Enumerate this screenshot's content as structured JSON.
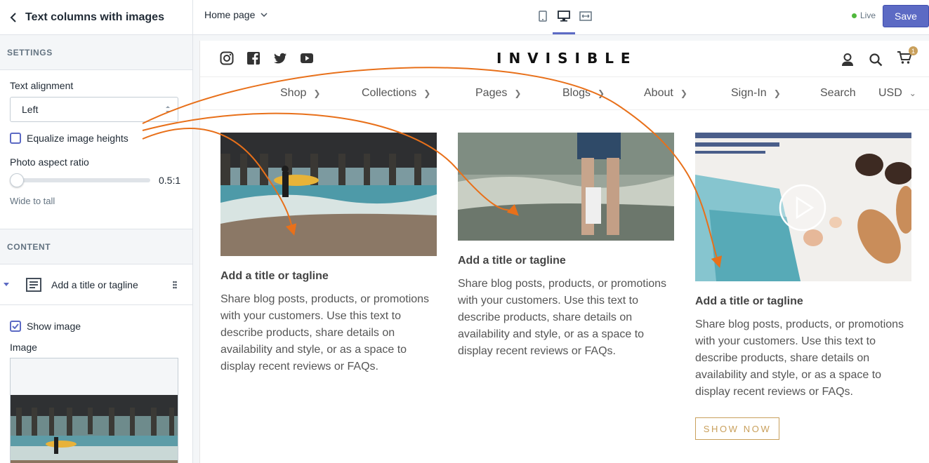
{
  "sidebar": {
    "title": "Text columns with images",
    "settings_label": "SETTINGS",
    "text_alignment_label": "Text alignment",
    "text_alignment_value": "Left",
    "equalize_label": "Equalize image heights",
    "equalize_checked": false,
    "aspect_label": "Photo aspect ratio",
    "aspect_value": "0.5:1",
    "aspect_help": "Wide to tall",
    "content_label": "CONTENT",
    "block_label": "Add a title or tagline",
    "show_image_label": "Show image",
    "show_image_checked": true,
    "image_label": "Image"
  },
  "topbar": {
    "page_select": "Home page",
    "live_label": "Live",
    "save_label": "Save",
    "accent": "#5c6ac4"
  },
  "store": {
    "logo": "INVISIBLE",
    "cart_count": "1",
    "nav": [
      {
        "label": "Shop",
        "has_chevron": true
      },
      {
        "label": "Collections",
        "has_chevron": true
      },
      {
        "label": "Pages",
        "has_chevron": true
      },
      {
        "label": "Blogs",
        "has_chevron": true
      },
      {
        "label": "About",
        "has_chevron": true
      },
      {
        "label": "Sign-In",
        "has_chevron": true
      },
      {
        "label": "Search",
        "has_chevron": false
      },
      {
        "label": "USD",
        "has_chevron": true
      }
    ],
    "columns": [
      {
        "image": "surfer-under-pier",
        "title": "Add a title or tagline",
        "body": "Share blog posts, products, or promotions with your customers. Use this text to describe products, share details on availability and style, or as a space to display recent reviews or FAQs."
      },
      {
        "image": "legs-in-surf",
        "title": "Add a title or tagline",
        "body": "Share blog posts, products, or promotions with your customers. Use this text to describe products, share details on availability and style, or as a space to display recent reviews or FAQs."
      },
      {
        "image": "beach-flatlay-with-play-button",
        "title": "Add a title or tagline",
        "body": "Share blog posts, products, or promotions with your customers. Use this text to describe products, share details on availability and style, or as a space to display recent reviews or FAQs.",
        "button": "SHOW NOW"
      }
    ],
    "accent": "#c9a05c"
  },
  "annotation_color": "#e8701a"
}
